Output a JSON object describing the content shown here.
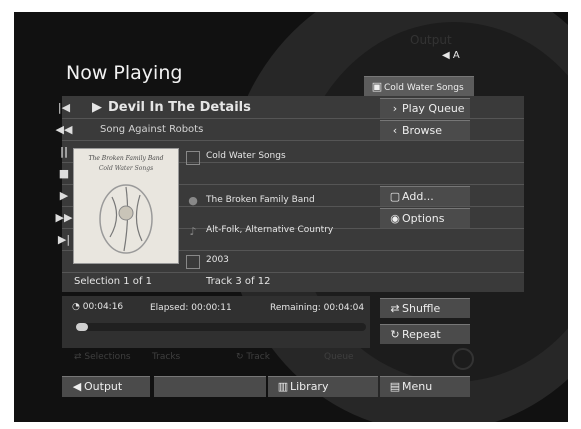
{
  "header": {
    "title": "Now Playing",
    "output_label": "Output",
    "output_speaker": "A"
  },
  "track": {
    "title": "Devil In The Details",
    "song_from": "Song Against Robots"
  },
  "info": {
    "album": "Cold Water Songs",
    "artist": "The Broken Family Band",
    "genre": "Alt-Folk, Alternative Country",
    "year": "2003"
  },
  "album_art": {
    "band_text": "The Broken Family Band",
    "album_text": "Cold Water Songs"
  },
  "right_menu": {
    "album_link": "Cold Water Songs",
    "play_queue": "Play Queue",
    "browse": "Browse",
    "add": "Add...",
    "options": "Options"
  },
  "status": {
    "selection": "Selection 1 of 1",
    "track_position": "Track 3 of 12"
  },
  "progress": {
    "total": "00:04:16",
    "elapsed": "Elapsed: 00:00:11",
    "remaining": "Remaining: 00:04:04",
    "fraction": 0.043
  },
  "toggles": {
    "shuffle": "Shuffle",
    "repeat": "Repeat"
  },
  "faint_tabs": {
    "selections": "Selections",
    "tracks": "Tracks",
    "track": "Track",
    "queue": "Queue"
  },
  "bottom_bar": {
    "output": "Output",
    "blank": "",
    "library": "Library",
    "menu": "Menu"
  },
  "colors": {
    "background": "#111111",
    "band": "#3a3a3a",
    "button": "#4b4b4b",
    "text": "#e6e6e6"
  }
}
